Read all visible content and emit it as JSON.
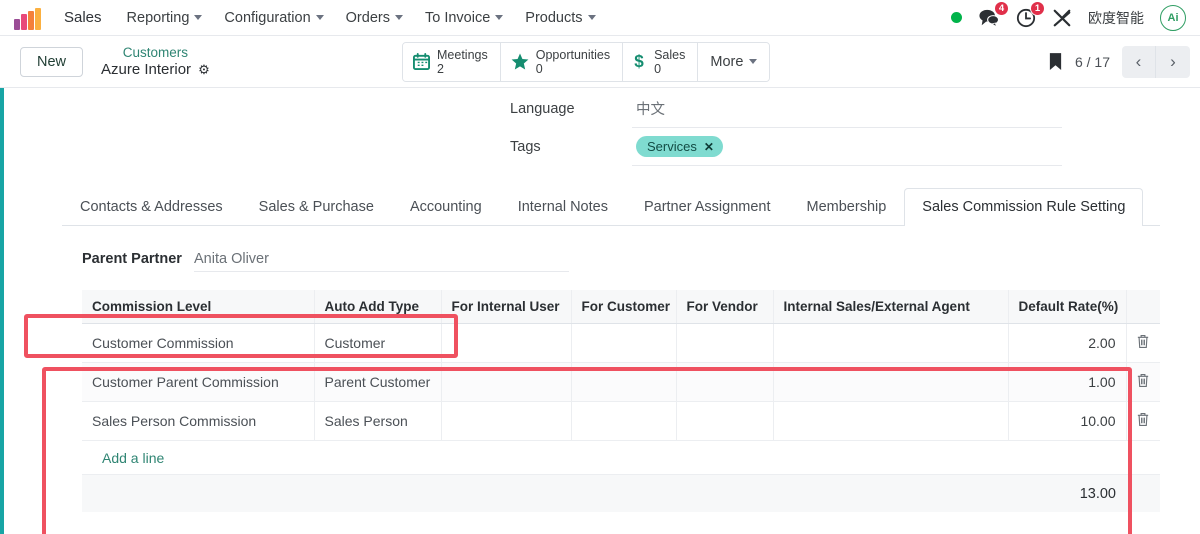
{
  "navbar": {
    "logo_icon": "bar-chart-logo",
    "app_name": "Sales",
    "menus": [
      {
        "label": "Reporting",
        "has_caret": true
      },
      {
        "label": "Configuration",
        "has_caret": true
      },
      {
        "label": "Orders",
        "has_caret": true
      },
      {
        "label": "To Invoice",
        "has_caret": true
      },
      {
        "label": "Products",
        "has_caret": true
      }
    ],
    "status_dot_color": "#00b34a",
    "messages": {
      "icon": "chat-bubble-icon",
      "badge": "4"
    },
    "activities": {
      "icon": "clock-icon",
      "badge": "1"
    },
    "tools_icon": "wrench-screwdriver-icon",
    "user_name": "欧度智能",
    "avatar_text": "Ai"
  },
  "control_panel": {
    "new_button": "New",
    "breadcrumb_parent": "Customers",
    "record_name": "Azure Interior",
    "gear_icon": "gear-icon",
    "stat_buttons": [
      {
        "icon": "calendar-icon",
        "label": "Meetings",
        "value": "2"
      },
      {
        "icon": "star-icon",
        "label": "Opportunities",
        "value": "0"
      },
      {
        "icon": "dollar-icon",
        "label": "Sales",
        "value": "0"
      }
    ],
    "more_label": "More",
    "bookmark_icon": "bookmark-icon",
    "pager": "6 / 17",
    "prev_label": "‹",
    "next_label": "›"
  },
  "form": {
    "fields": [
      {
        "label": "Language",
        "value": "中文"
      }
    ],
    "tags_label": "Tags",
    "tags": [
      {
        "name": "Services",
        "remove": "✕",
        "color": "#7fdbd0"
      }
    ]
  },
  "tabs": [
    {
      "label": "Contacts & Addresses",
      "active": false
    },
    {
      "label": "Sales & Purchase",
      "active": false
    },
    {
      "label": "Accounting",
      "active": false
    },
    {
      "label": "Internal Notes",
      "active": false
    },
    {
      "label": "Partner Assignment",
      "active": false
    },
    {
      "label": "Membership",
      "active": false
    },
    {
      "label": "Sales Commission Rule Setting",
      "active": true
    }
  ],
  "parent_partner": {
    "label": "Parent Partner",
    "value": "Anita Oliver"
  },
  "commission_table": {
    "columns": [
      "Commission Level",
      "Auto Add Type",
      "For Internal User",
      "For Customer",
      "For Vendor",
      "Internal Sales/External Agent",
      "Default Rate(%)"
    ],
    "rows": [
      {
        "commission_level": "Customer Commission",
        "auto_add_type": "Customer",
        "for_internal_user": "",
        "for_customer": "",
        "for_vendor": "",
        "internal_sales_external_agent": "",
        "default_rate": "2.00",
        "delete_icon": "trash-icon"
      },
      {
        "commission_level": "Customer Parent Commission",
        "auto_add_type": "Parent Customer",
        "for_internal_user": "",
        "for_customer": "",
        "for_vendor": "",
        "internal_sales_external_agent": "",
        "default_rate": "1.00",
        "delete_icon": "trash-icon"
      },
      {
        "commission_level": "Sales Person Commission",
        "auto_add_type": "Sales Person",
        "for_internal_user": "",
        "for_vendor": "",
        "for_customer": "",
        "internal_sales_external_agent": "",
        "default_rate": "10.00",
        "delete_icon": "trash-icon"
      }
    ],
    "add_line_label": "Add a line",
    "total": "13.00"
  },
  "annotations": {
    "color": "#ef5160",
    "boxes": [
      "parent-partner-highlight",
      "commission-table-highlight"
    ]
  }
}
